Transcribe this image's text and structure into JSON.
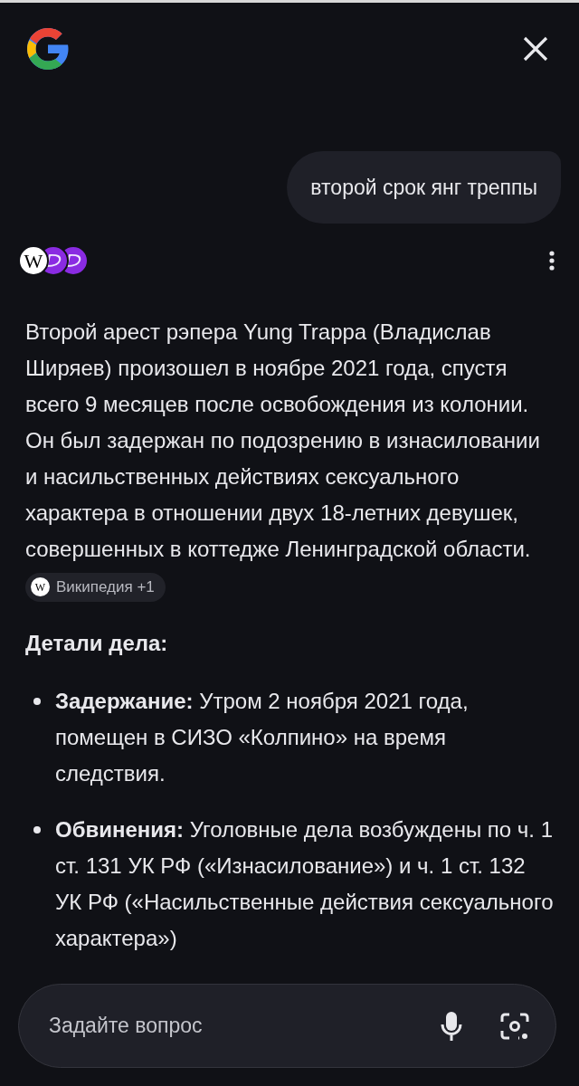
{
  "query": "второй срок янг треппы",
  "sources": [
    {
      "kind": "wikipedia",
      "glyph": "W"
    },
    {
      "kind": "other"
    },
    {
      "kind": "other"
    }
  ],
  "answer": {
    "paragraph": "Второй арест рэпера Yung Trappa (Владислав Ширяев) произошел в ноябре 2021 года, спустя всего 9 месяцев после освобождения из колонии. Он был задержан по подозрению в изнасиловании и насильственных действиях сексуального характера в отношении двух 18-летних девушек, совершенных в коттедже Ленинградской области.",
    "citation": {
      "glyph": "W",
      "label": "Википедия +1"
    },
    "heading": "Детали дела:",
    "bullets": [
      "**Задержание:** Утром 2 ноября 2021 года, помещен в СИЗО «Колпино» на время следствия.",
      "**Обвинения:** Уголовные дела возбуждены по ч. 1 ст. 131 УК РФ («Изнасилование») и ч. 1 ст. 132 УК РФ («Насильственные действия сексуального характера»)"
    ]
  },
  "input": {
    "placeholder": "Задайте вопрос"
  }
}
